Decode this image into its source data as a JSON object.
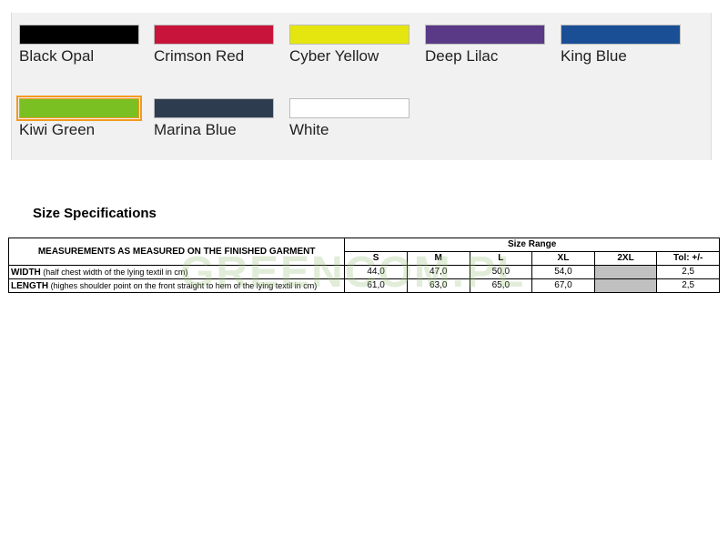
{
  "colors": {
    "swatches": [
      {
        "label": "Black Opal",
        "hex": "#000000",
        "selected": false
      },
      {
        "label": "Crimson Red",
        "hex": "#c8143a",
        "selected": false
      },
      {
        "label": "Cyber Yellow",
        "hex": "#e5e510",
        "selected": false
      },
      {
        "label": "Deep Lilac",
        "hex": "#5a3a86",
        "selected": false
      },
      {
        "label": "King Blue",
        "hex": "#1a4f95",
        "selected": false
      },
      {
        "label": "Kiwi Green",
        "hex": "#7ac023",
        "selected": true
      },
      {
        "label": "Marina Blue",
        "hex": "#2d3d4f",
        "selected": false
      },
      {
        "label": "White",
        "hex": "#ffffff",
        "selected": false
      }
    ],
    "selection_accent": "#f39a1f"
  },
  "size_specs": {
    "title": "Size Specifications",
    "measure_header": "MEASUREMENTS AS MEASURED ON THE FINISHED GARMENT",
    "range_header": "Size Range",
    "sizes": [
      "S",
      "M",
      "L",
      "XL",
      "2XL"
    ],
    "tol_header": "Tol: +/-",
    "rows": [
      {
        "name": "WIDTH",
        "desc": " (half chest width of the lying textil in cm)",
        "values": [
          "44,0",
          "47,0",
          "50,0",
          "54,0",
          ""
        ],
        "tol": "2,5"
      },
      {
        "name": "LENGTH",
        "desc": " (highes shoulder point on the front straight to hem of the lying textil in cm)",
        "values": [
          "61,0",
          "63,0",
          "65,0",
          "67,0",
          ""
        ],
        "tol": "2,5"
      }
    ]
  },
  "watermark": "GREENCOM.PL"
}
